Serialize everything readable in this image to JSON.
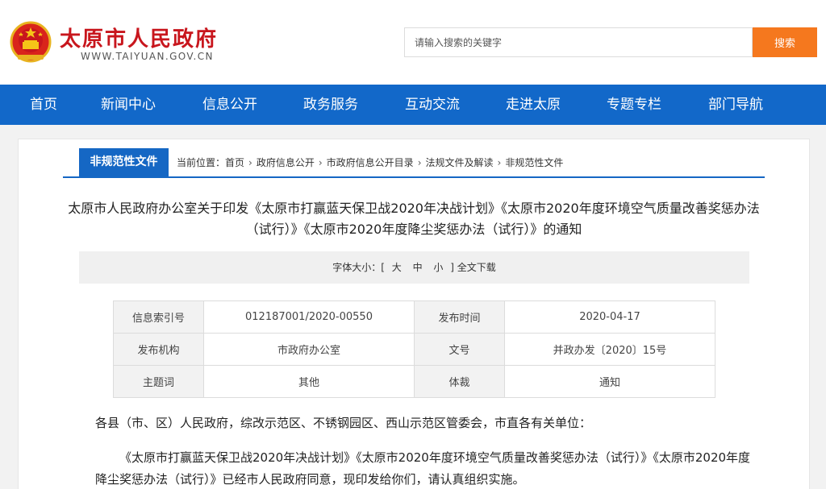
{
  "header": {
    "site_title": "太原市人民政府",
    "site_domain": "WWW.TAIYUAN.GOV.CN",
    "search_placeholder": "请输入搜索的关键字",
    "search_button": "搜索"
  },
  "nav": {
    "items": [
      "首页",
      "新闻中心",
      "信息公开",
      "政务服务",
      "互动交流",
      "走进太原",
      "专题专栏",
      "部门导航"
    ]
  },
  "section_tab": "非规范性文件",
  "breadcrumb": {
    "prefix": "当前位置：",
    "items": [
      "首页",
      "政府信息公开",
      "市政府信息公开目录",
      "法规文件及解读",
      "非规范性文件"
    ],
    "separator": "›"
  },
  "document": {
    "title": "太原市人民政府办公室关于印发《太原市打赢蓝天保卫战2020年决战计划》《太原市2020年度环境空气质量改善奖惩办法（试行）》《太原市2020年度降尘奖惩办法（试行）》的通知",
    "font_size_label": "字体大小：",
    "bracket_open": "[",
    "bracket_close": "]",
    "font_sizes": [
      "大",
      "中",
      "小"
    ],
    "download": "全文下载",
    "meta": {
      "index_no_label": "信息索引号",
      "index_no": "012187001/2020-00550",
      "publish_time_label": "发布时间",
      "publish_time": "2020-04-17",
      "publisher_label": "发布机构",
      "publisher": "市政府办公室",
      "doc_no_label": "文号",
      "doc_no": "并政办发〔2020〕15号",
      "subject_label": "主题词",
      "subject": "其他",
      "genre_label": "体裁",
      "genre": "通知"
    },
    "salutation": "各县（市、区）人民政府，综改示范区、不锈钢园区、西山示范区管委会，市直各有关单位：",
    "body": "《太原市打赢蓝天保卫战2020年决战计划》《太原市2020年度环境空气质量改善奖惩办法（试行）》《太原市2020年度降尘奖惩办法（试行）》已经市人民政府同意，现印发给你们，请认真组织实施。"
  },
  "colors": {
    "brand_red": "#c8161d",
    "nav_blue": "#1268c9",
    "search_orange": "#f5781e"
  }
}
